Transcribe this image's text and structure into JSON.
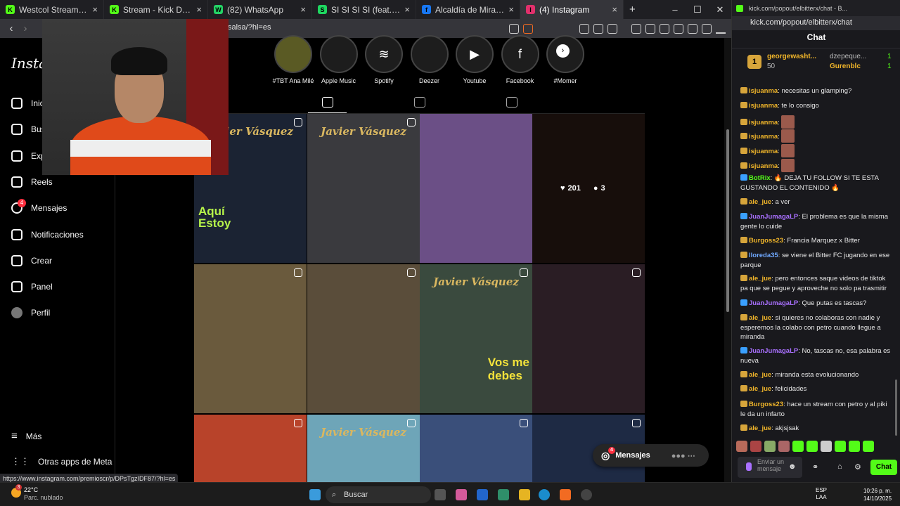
{
  "browser": {
    "tabs": [
      {
        "label": "Westcol Stream - Watch Live on Kick",
        "color": "#53fc18",
        "glyph": "K"
      },
      {
        "label": "Stream - Kick Dashboard",
        "color": "#53fc18",
        "glyph": "K"
      },
      {
        "label": "(82) WhatsApp",
        "color": "#25d366",
        "glyph": "W"
      },
      {
        "label": "SI SI SI SI (feat. The Academy",
        "color": "#1ed760",
        "glyph": "S"
      },
      {
        "label": "Alcaldía de Miranda - Cauca | Fa",
        "color": "#1877f2",
        "glyph": "f"
      },
      {
        "label": "(4) Instagram",
        "color": "#e1306c",
        "glyph": "I"
      }
    ],
    "new_tab": "+",
    "url": "salsa/?hl=es",
    "status_url": "https://www.instagram.com/premioscr/p/DPsTgzIDF87/?hl=es",
    "window_controls": [
      "–",
      "☐",
      "✕"
    ]
  },
  "instagram": {
    "logo": "Instag",
    "nav": [
      {
        "label": "Inic",
        "icon": "home-icon"
      },
      {
        "label": "Bus",
        "icon": "search-icon"
      },
      {
        "label": "Exp",
        "icon": "compass-icon"
      },
      {
        "label": "Reels",
        "icon": "reels-icon"
      },
      {
        "label": "Mensajes",
        "icon": "messenger-icon",
        "badge": "4"
      },
      {
        "label": "Notificaciones",
        "icon": "heart-icon"
      },
      {
        "label": "Crear",
        "icon": "plus-icon"
      },
      {
        "label": "Panel",
        "icon": "dashboard-icon"
      },
      {
        "label": "Perfil",
        "icon": "avatar-icon"
      }
    ],
    "more": "Más",
    "meta_apps": "Otras apps de Meta",
    "highlights": [
      {
        "label": "#TBT Ana Milé",
        "glyph": ""
      },
      {
        "label": "Apple Music",
        "glyph": ""
      },
      {
        "label": "Spotify",
        "glyph": "≋"
      },
      {
        "label": "Deezer",
        "glyph": ""
      },
      {
        "label": "Youtube",
        "glyph": "▶"
      },
      {
        "label": "Facebook",
        "glyph": "f"
      },
      {
        "label": "#Momer",
        "glyph": ""
      }
    ],
    "highlight_next": "›",
    "posts": [
      {
        "brand": "Javier Vásquez",
        "text": "Aquí\nEstoy",
        "bg": "#1b2333"
      },
      {
        "brand": "Javier Vásquez",
        "text": "",
        "bg": "#3a3a3e"
      },
      {
        "brand": "",
        "text": "",
        "bg": "#6b4f86"
      },
      {
        "brand": "",
        "text": "",
        "bg": "#2a1a14"
      },
      {
        "brand": "",
        "text": "",
        "bg": "#6a5a3d"
      },
      {
        "brand": "",
        "text": "",
        "bg": "#5a4d3a"
      },
      {
        "brand": "Javier Vásquez",
        "text": "Vos me\ndebes",
        "bg": "#3a4a3e"
      },
      {
        "brand": "",
        "text": "",
        "bg": "#2a1d24"
      },
      {
        "brand": "",
        "text": "",
        "bg": "#b8432a"
      },
      {
        "brand": "Javier Vásquez",
        "text": "",
        "bg": "#6ea5b8"
      },
      {
        "brand": "",
        "text": "",
        "bg": "#3a4f7a"
      },
      {
        "brand": "",
        "text": "",
        "bg": "#1e2a44"
      }
    ],
    "hover_stats": {
      "likes": "201",
      "comments": "3"
    },
    "messages_button": "Mensajes",
    "messages_badge": "4"
  },
  "kick": {
    "window_title": "kick.com/popout/elbitterx/chat - B...",
    "url": "kick.com/popout/elbitterx/chat",
    "title": "Chat",
    "pinned": {
      "rank": "1",
      "user": "georgewasht...",
      "amount": "50",
      "right_users": [
        {
          "name": "dzepeque...",
          "count": "1"
        },
        {
          "name": "Gurenblc",
          "count": "1"
        }
      ]
    },
    "messages": [
      {
        "user": "isjuanma",
        "color": "#f0b52a",
        "text": "necesitas un glamping?",
        "emote": false
      },
      {
        "user": "isjuanma",
        "color": "#f0b52a",
        "text": "te lo consigo",
        "emote": false
      },
      {
        "user": "isjuanma",
        "color": "#f0b52a",
        "text": "",
        "emote": true
      },
      {
        "user": "isjuanma",
        "color": "#f0b52a",
        "text": "",
        "emote": true
      },
      {
        "user": "isjuanma",
        "color": "#f0b52a",
        "text": "",
        "emote": true
      },
      {
        "user": "isjuanma",
        "color": "#f0b52a",
        "text": "",
        "emote": true
      },
      {
        "user": "BotRix",
        "color": "#53fc18",
        "text": "🔥 DEJA TU FOLLOW SI TE ESTA GUSTANDO EL CONTENIDO 🔥",
        "emote": false
      },
      {
        "user": "ale_jue",
        "color": "#f0b52a",
        "text": "a ver",
        "emote": false
      },
      {
        "user": "JuanJumagaLP",
        "color": "#a970ff",
        "text": "El problema es que la misma gente lo cuide",
        "emote": false
      },
      {
        "user": "Burgoss23",
        "color": "#f0b52a",
        "text": "Francia Marquez x Bitter",
        "emote": false
      },
      {
        "user": "lloreda35",
        "color": "#6fa8ff",
        "text": "se viene el Bitter FC jugando en ese parque",
        "emote": false
      },
      {
        "user": "ale_jue",
        "color": "#f0b52a",
        "text": "pero entonces saque videos de tiktok pa que se pegue y aproveche no solo pa trasmitir",
        "emote": false
      },
      {
        "user": "JuanJumagaLP",
        "color": "#a970ff",
        "text": "Que putas es tascas?",
        "emote": false
      },
      {
        "user": "ale_jue",
        "color": "#f0b52a",
        "text": "si quieres no colaboras con nadie y esperemos la colabo con petro cuando llegue a miranda",
        "emote": false
      },
      {
        "user": "JuanJumagaLP",
        "color": "#a970ff",
        "text": "No, tascas no, esa palabra es nueva",
        "emote": false
      },
      {
        "user": "ale_jue",
        "color": "#f0b52a",
        "text": "miranda esta evolucionando",
        "emote": false
      },
      {
        "user": "ale_jue",
        "color": "#f0b52a",
        "text": "felicidades",
        "emote": false
      },
      {
        "user": "Burgoss23",
        "color": "#f0b52a",
        "text": "hace un stream con petro y al piki le da un infarto",
        "emote": false
      },
      {
        "user": "ale_jue",
        "color": "#f0b52a",
        "text": "akjsjsak",
        "emote": false
      }
    ],
    "input_placeholder": "Enviar un mensaje",
    "chat_button": "Chat"
  },
  "taskbar": {
    "temperature": "22°C",
    "weather": "Parc. nublado",
    "weather_badge": "3",
    "search_placeholder": "Buscar",
    "language": "ESP",
    "layout": "LAA",
    "time": "10:26 p. m.",
    "date": "14/10/2025"
  }
}
